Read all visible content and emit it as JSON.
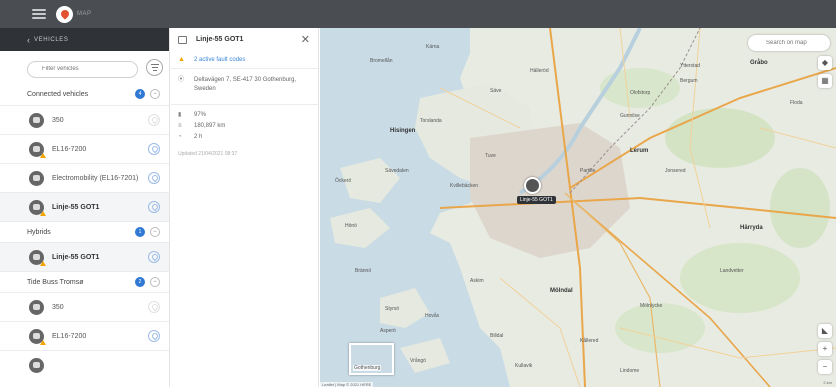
{
  "app": {
    "title": "MAP"
  },
  "sidebar": {
    "header_title": "VEHICLES",
    "filter_placeholder": "Filter vehicles",
    "groups": [
      {
        "name": "Connected vehicles",
        "count": "4",
        "vehicles": [
          "350",
          "EL16-7200",
          "Electromobility (EL16-7201)",
          "Linje-55 GOT1"
        ]
      },
      {
        "name": "Hybrids",
        "count": "1",
        "vehicles": [
          "Linje-55 GOT1"
        ]
      },
      {
        "name": "Tide Buss Tromsø",
        "count": "2",
        "vehicles": [
          "350",
          "EL16-7200"
        ]
      }
    ]
  },
  "detail": {
    "vehicle_name": "Linje-55 GOT1",
    "fault_codes": "2 active fault codes",
    "address": "Deltavägen 7, SE-417 30 Gothenburg, Sweden",
    "fuel": "97%",
    "odometer": "180,897 km",
    "engine_hours": "2 h",
    "updated": "Updated 21/04/2021 08:37"
  },
  "map": {
    "search_placeholder": "Search on map",
    "marker_label": "Linje-55 GOT1",
    "minimap_label": "Gothenburg",
    "attribution": "Leaflet | Map © 2021 HERE",
    "scale": "2 km",
    "place_labels": [
      "Kärna",
      "Hisingen",
      "Bromellån",
      "Hälleröd",
      "Olofstorp",
      "Ytterstad",
      "Gråbo",
      "Bergum",
      "Gunnilse",
      "Öckerö",
      "Torslanda",
      "Hönö",
      "Säve",
      "Tuve",
      "Kvillebäcken",
      "Lerum",
      "Partille",
      "Sävedalen",
      "Härryda",
      "Mölndal",
      "Askim",
      "Hovås",
      "Billdal",
      "Styrsö",
      "Vrångö",
      "Asperö",
      "Kullavik",
      "Landvetter",
      "Floda",
      "Jonsered",
      "Mölnlycke",
      "Kållered",
      "Lindome",
      "Brännö"
    ]
  }
}
